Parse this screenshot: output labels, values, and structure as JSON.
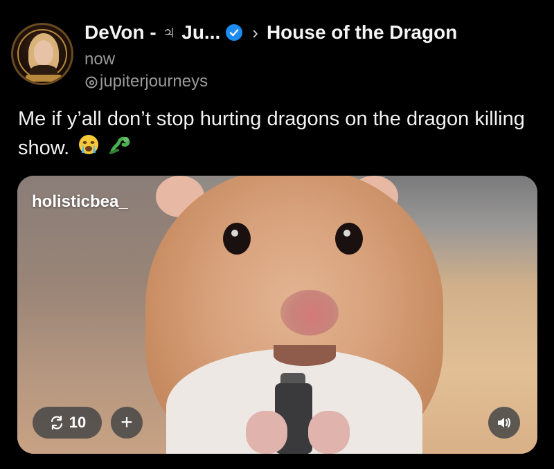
{
  "post": {
    "author_name": "DeVon - ♃ Ju...",
    "separator": "›",
    "community": "House of the Dragon",
    "timestamp": "now",
    "handle": "jupiterjourneys",
    "text": "Me if y’all don’t stop hurting dragons on the dragon killing show.",
    "emojis": [
      "loudly-crying-face",
      "dragon"
    ]
  },
  "media": {
    "overlay_username": "holisticbea_",
    "repost_count": "10",
    "add_label": "+",
    "sound_icon": "speaker-icon"
  },
  "colors": {
    "background": "#000000",
    "verified": "#1d8cf0",
    "pill": "#464648"
  }
}
